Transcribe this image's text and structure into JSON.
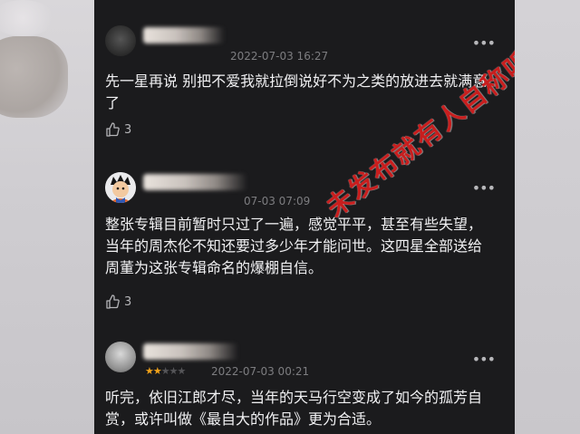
{
  "watermark": "未发布就有人自称听过",
  "comments": [
    {
      "date": "2022-07-03 16:27",
      "text": "先一星再说 别把不爱我就拉倒说好不为之类的放进去就满意了",
      "likes": "3"
    },
    {
      "date": "07-03 07:09",
      "text": "整张专辑目前暂时只过了一遍，感觉平平，甚至有些失望，当年的周杰伦不知还要过多少年才能问世。这四星全部送给周董为这张专辑命名的爆棚自信。",
      "likes": "3"
    },
    {
      "date": "2022-07-03 00:21",
      "rating": 2,
      "rating_max": 5,
      "text": "听完，依旧江郎才尽，当年的天马行空变成了如今的孤芳自赏，或许叫做《最自大的作品》更为合适。"
    }
  ],
  "icons": {
    "more": "more-dots-icon",
    "like": "thumbs-up-icon"
  },
  "colors": {
    "panel": "#1b1b1d",
    "star": "#f0a21a",
    "watermark": "#c81e1e"
  }
}
